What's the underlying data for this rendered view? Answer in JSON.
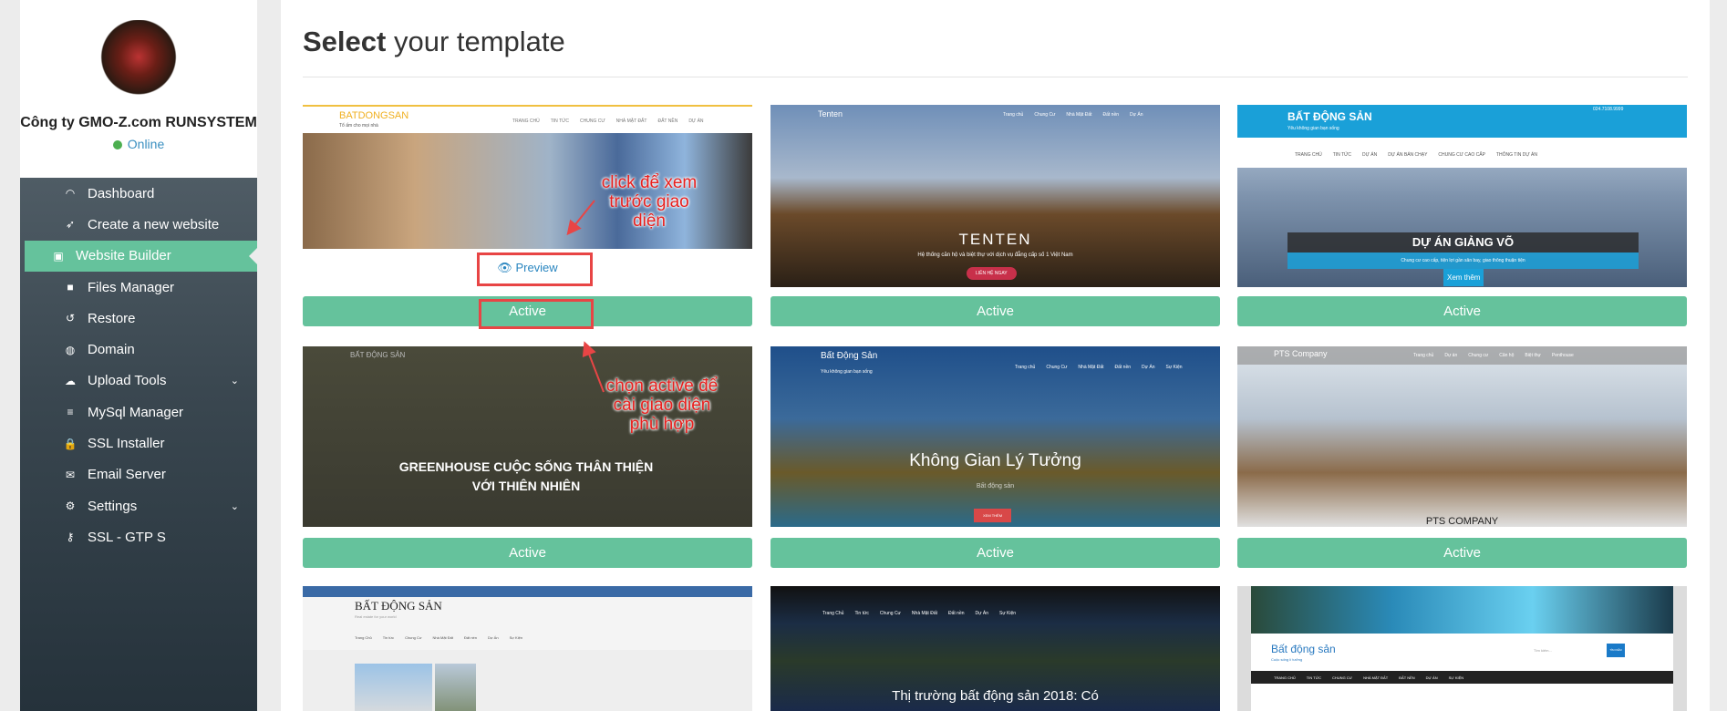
{
  "sidebar": {
    "company": "Công ty GMO-Z.com RUNSYSTEM",
    "status": "Online",
    "items": [
      {
        "label": "Dashboard",
        "icon": "dashboard-icon"
      },
      {
        "label": "Create a new website",
        "icon": "rocket-icon"
      },
      {
        "label": "Website Builder",
        "icon": "builder-icon",
        "active": true
      },
      {
        "label": "Files Manager",
        "icon": "folder-icon"
      },
      {
        "label": "Restore",
        "icon": "history-icon"
      },
      {
        "label": "Domain",
        "icon": "globe-icon"
      },
      {
        "label": "Upload Tools",
        "icon": "cloud-upload-icon",
        "has_submenu": true
      },
      {
        "label": "MySql Manager",
        "icon": "database-icon"
      },
      {
        "label": "SSL Installer",
        "icon": "lock-icon"
      },
      {
        "label": "Email Server",
        "icon": "envelope-icon"
      },
      {
        "label": "Settings",
        "icon": "cogs-icon",
        "has_submenu": true
      },
      {
        "label": "SSL - GTP S",
        "icon": "key-icon"
      }
    ]
  },
  "main": {
    "title_bold": "Select",
    "title_rest": " your template",
    "preview_label": "Preview",
    "active_label": "Active",
    "templates": [
      {
        "brand": "BATDONGSAN",
        "tagline": "Tổ ấm cho mọi nhà",
        "nav": [
          "TRANG CHỦ",
          "TIN TỨC",
          "CHUNG CƯ",
          "NHÀ MẶT ĐẤT",
          "ĐẤT NỀN",
          "DỰ ÁN"
        ]
      },
      {
        "brand": "Tenten",
        "nav": [
          "Trang chủ",
          "Chung Cư",
          "Nhà Mặt Đất",
          "Đất nền",
          "Dự Án"
        ],
        "hero": "TENTEN",
        "sub": "Hệ thống căn hộ và biệt thự với dịch vụ đẳng cấp số 1 Việt Nam",
        "cta": "LIÊN HỆ NGAY"
      },
      {
        "brand": "BẤT ĐỘNG SẢN",
        "tagline": "Yêu không gian bạn sống",
        "phone": "024.7108.9999",
        "nav": [
          "TRANG CHỦ",
          "TIN TỨC",
          "DỰ ÁN",
          "DỰ ÁN BÁN CHẠY",
          "CHUNG CƯ CAO CẤP",
          "THÔNG TIN DỰ ÁN"
        ],
        "hero": "DỰ ÁN GIẢNG VÕ",
        "sub": "Chung cư cao cấp, tiện lợi gần sân bay, giao thông thuận tiện",
        "cta": "Xem thêm"
      },
      {
        "brand": "BẤT ĐỘNG SẢN",
        "hero": "GREENHOUSE CUỘC SỐNG THÂN THIỆN VỚI THIÊN NHIÊN"
      },
      {
        "brand": "Bất Động Sản",
        "tagline": "Yêu không gian bạn sống",
        "nav": [
          "Trang chủ",
          "Chung Cư",
          "Nhà Mặt Đất",
          "Đất nền",
          "Dự Án",
          "Sự Kiện"
        ],
        "hero": "Không Gian Lý Tưởng",
        "sub": "Bất động sản",
        "cta": "XEM THÊM"
      },
      {
        "brand": "PTS Company",
        "nav": [
          "Trang chủ",
          "Dự án",
          "Chung cư",
          "Căn hộ",
          "Biệt thự",
          "Penthouse"
        ],
        "hero": "PTS COMPANY"
      },
      {
        "brand": "BẤT ĐỘNG SẢN",
        "tagline": "Real estate for your world",
        "nav": [
          "Trang Chủ",
          "Tin tức",
          "Chung Cư",
          "Nhà Mặt Đất",
          "Đất nền",
          "Dự Án",
          "Sự Kiện"
        ]
      },
      {
        "nav": [
          "Trang Chủ",
          "Tin tức",
          "Chung Cư",
          "Nhà Mặt Đất",
          "Đất nền",
          "Dự Án",
          "Sự Kiện"
        ],
        "hero": "Thị trường bất động sản 2018: Có"
      },
      {
        "brand": "Bất động sản",
        "tagline": "Cuộc sống lí tưởng",
        "search_placeholder": "Tìm kiếm...",
        "search_btn": "TÌM KIẾM",
        "nav": [
          "TRANG CHỦ",
          "TIN TỨC",
          "CHUNG CƯ",
          "NHÀ MẶT ĐẤT",
          "ĐẤT NỀN",
          "DỰ ÁN",
          "SỰ KIỆN"
        ]
      }
    ]
  },
  "annotations": {
    "preview_note": "click để xem trước giao diện",
    "active_note": "chọn active để cài giao diện phù hợp"
  },
  "colors": {
    "accent": "#65c29c",
    "annotation": "#e84545",
    "sidebar": "#3a4750"
  }
}
